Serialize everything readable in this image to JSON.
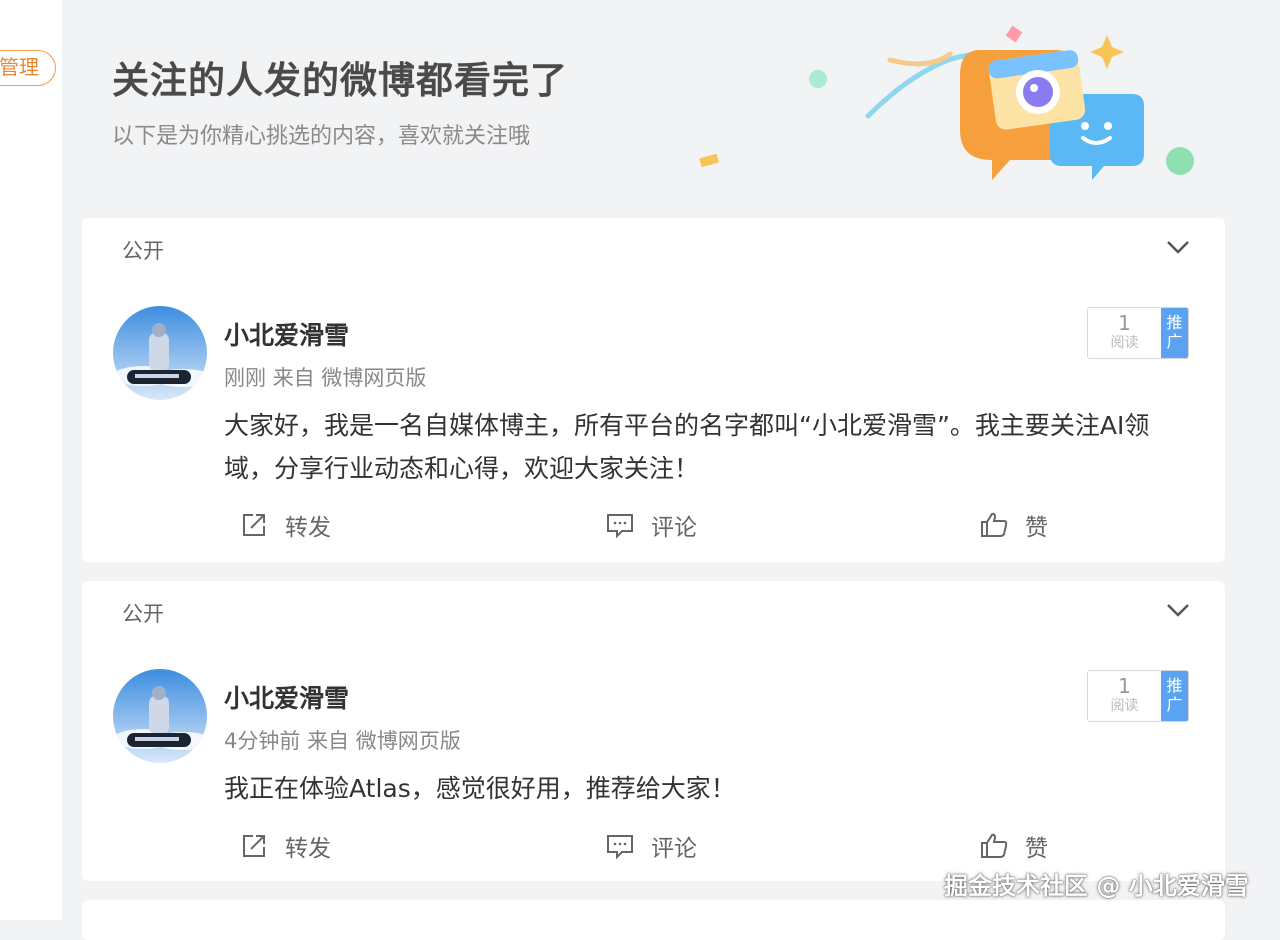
{
  "sidebar": {
    "manage_label": "管理"
  },
  "banner": {
    "title": "关注的人发的微博都看完了",
    "subtitle": "以下是为你精心挑选的内容，喜欢就关注哦"
  },
  "posts": [
    {
      "visibility": "公开",
      "username": "小北爱滑雪",
      "time": "刚刚",
      "source": "来自 微博网页版",
      "reads": "1",
      "reads_label": "阅读",
      "promote_label": "推广",
      "text": "大家好，我是一名自媒体博主，所有平台的名字都叫“小北爱滑雪”。我主要关注AI领域，分享行业动态和心得，欢迎大家关注！",
      "repost_label": "转发",
      "comment_label": "评论",
      "like_label": "赞"
    },
    {
      "visibility": "公开",
      "username": "小北爱滑雪",
      "time": "4分钟前",
      "source": "来自 微博网页版",
      "reads": "1",
      "reads_label": "阅读",
      "promote_label": "推广",
      "text": "我正在体验Atlas，感觉很好用，推荐给大家！",
      "repost_label": "转发",
      "comment_label": "评论",
      "like_label": "赞"
    }
  ],
  "watermark": "掘金技术社区 @ 小北爱滑雪",
  "colors": {
    "accent_orange": "#e8872e",
    "promo_blue": "#5aa3f0"
  }
}
